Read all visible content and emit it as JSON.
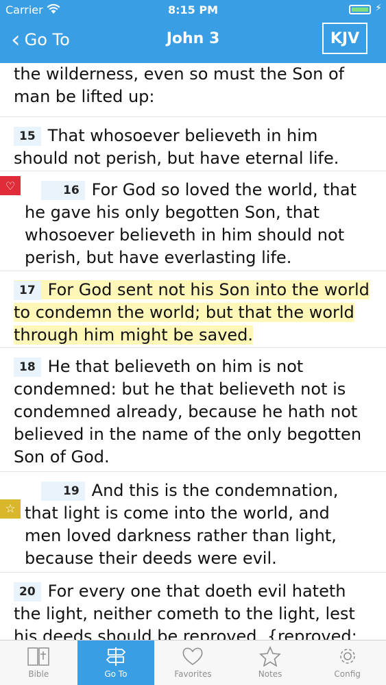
{
  "status_bar": {
    "carrier": "Carrier",
    "time": "8:15 PM"
  },
  "nav": {
    "back_label": "Go To",
    "title": "John 3",
    "version_button": "KJV"
  },
  "verses": [
    {
      "text": "the wilderness, even so must the Son of man be lifted up:"
    },
    {
      "number": "15",
      "text": "That whosoever believeth in him should not perish, but have eternal life."
    },
    {
      "number": "16",
      "text": "For God so loved the world, that he gave his only begotten Son, that whosoever believeth in him should not perish, but have everlasting life.",
      "badge": "heart-icon"
    },
    {
      "number": "17",
      "text": "For God sent not his Son into the world to condemn the world; but that the world through him might be saved.",
      "highlight": "#fff7b8"
    },
    {
      "number": "18",
      "text": "He that believeth on him is not condemned: but he that believeth not is condemned already, because he hath not believed in the name of the only begotten Son of God."
    },
    {
      "number": "19",
      "text": "And this is the condemnation, that light is come into the world, and men loved darkness rather than light, because their deeds were evil.",
      "badge": "star-icon"
    },
    {
      "number": "20",
      "text": "For every one that doeth evil hateth the light, neither cometh to the light, lest his deeds should be reproved. {reproved: or,"
    }
  ],
  "tabs": [
    {
      "label": "Bible",
      "icon": "book-icon"
    },
    {
      "label": "Go To",
      "icon": "signpost-icon",
      "active": true
    },
    {
      "label": "Favorites",
      "icon": "heart-icon"
    },
    {
      "label": "Notes",
      "icon": "star-icon"
    },
    {
      "label": "Config",
      "icon": "gear-icon"
    }
  ],
  "colors": {
    "accent": "#3a9ee4",
    "highlight": "#fff7b8",
    "favorite": "#e02b38",
    "note": "#d9b62a"
  }
}
